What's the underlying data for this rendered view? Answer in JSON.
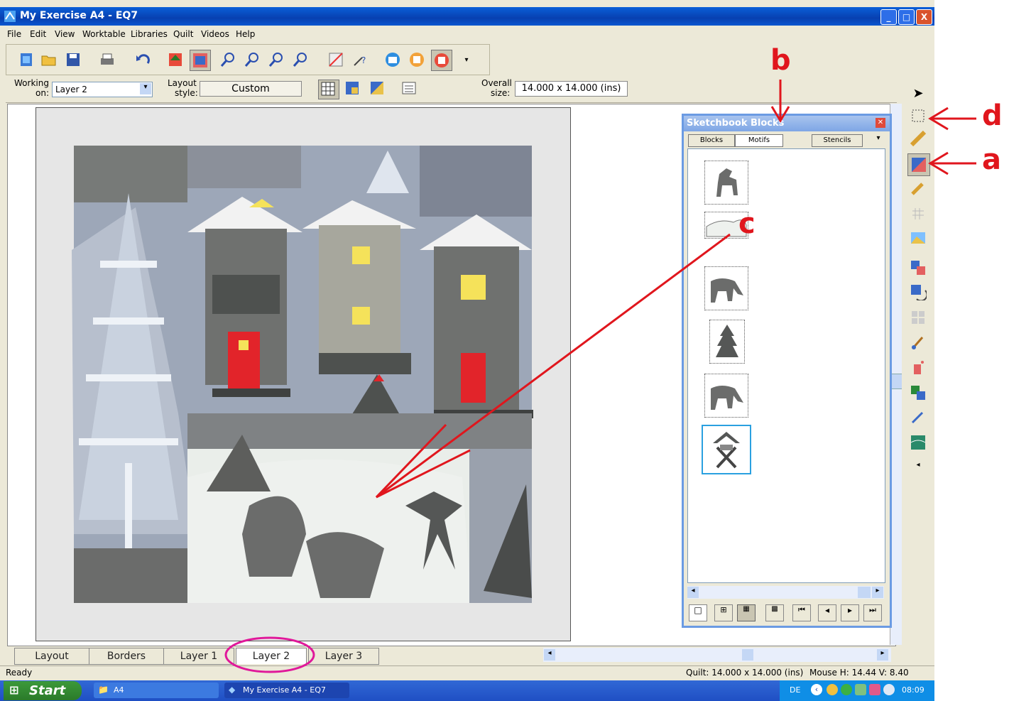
{
  "window": {
    "title": "My Exercise A4 - EQ7",
    "controls": [
      "_",
      "□",
      "X"
    ]
  },
  "menu": [
    "File",
    "Edit",
    "View",
    "Worktable",
    "Libraries",
    "Quilt",
    "Videos",
    "Help"
  ],
  "options": {
    "working_on_label_1": "Working",
    "working_on_label_2": "on:",
    "working_on_value": "Layer 2",
    "layout_style_label_1": "Layout",
    "layout_style_label_2": "style:",
    "layout_style_value": "Custom",
    "overall_size_label_1": "Overall",
    "overall_size_label_2": "size:",
    "overall_size_value": "14.000 x 14.000 (ins)"
  },
  "layer_tabs": [
    "Layout",
    "Borders",
    "Layer 1",
    "Layer 2",
    "Layer 3"
  ],
  "active_layer_tab": "Layer 2",
  "status": {
    "left": "Ready",
    "quilt": "Quilt: 14.000 x 14.000 (ins)",
    "mouse": "Mouse  H: 14.44  V: 8.40"
  },
  "sketchbook": {
    "title": "Sketchbook Blocks",
    "tabs": [
      "Blocks",
      "Motifs",
      "Stencils"
    ],
    "active_tab": "Motifs",
    "motifs": [
      "deer-standing",
      "snow-drift",
      "deer-grazing",
      "fir-tree",
      "deer-grazing",
      "feeding-rack"
    ]
  },
  "taskbar": {
    "start": "Start",
    "folder_item": "A4",
    "app_item": "My Exercise A4 - EQ7",
    "lang": "DE",
    "clock": "08:09"
  },
  "annotations": {
    "a": "a",
    "b": "b",
    "c": "c",
    "d": "d"
  },
  "colors": {
    "annotation": "#e0161d",
    "circle": "#e0189a",
    "xp_blue": "#0a56d0"
  }
}
